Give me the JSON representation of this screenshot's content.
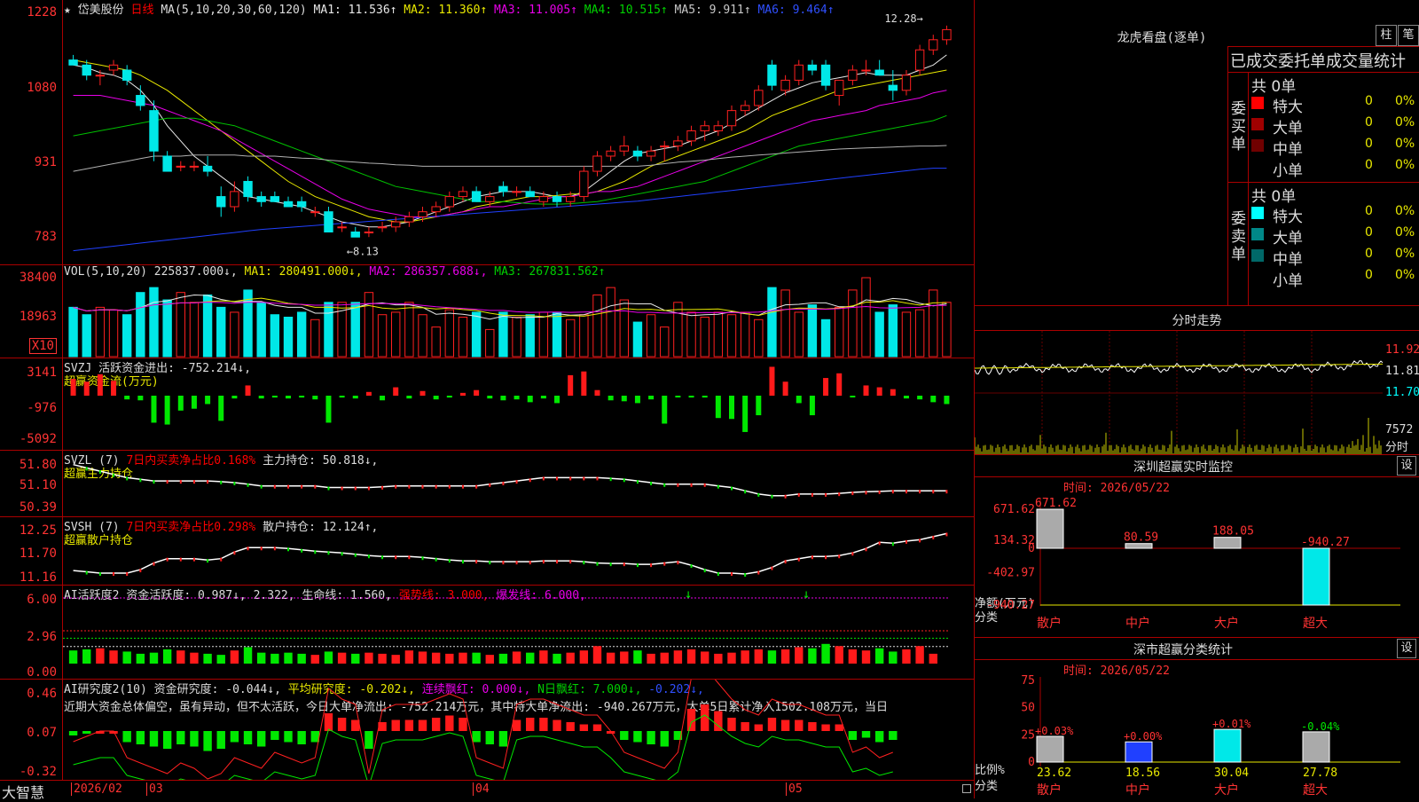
{
  "price": {
    "arrow": "★",
    "stock_name": "岱美股份",
    "period": "日线",
    "ma_params": "MA(5,10,20,30,60,120)",
    "mas": [
      {
        "label": "MA1: 11.536↑",
        "color": "#e8e8e8"
      },
      {
        "label": "MA2: 11.360↑",
        "color": "#e8e800"
      },
      {
        "label": "MA3: 11.005↑",
        "color": "#e800e8"
      },
      {
        "label": "MA4: 10.515↑",
        "color": "#00d000"
      },
      {
        "label": "MA5: 9.911↑",
        "color": "#c8c8c8"
      },
      {
        "label": "MA6: 9.464↑",
        "color": "#3050ff"
      }
    ],
    "y_labels": [
      "1228",
      "1080",
      "931",
      "783"
    ],
    "high_mark": "12.28",
    "low_mark": "8.13"
  },
  "volume": {
    "title": "VOL(5,10,20)",
    "value": "225837.000↓,",
    "ma1": "MA1: 280491.000↓,",
    "ma2": "MA2: 286357.688↓,",
    "ma3": "MA3: 267831.562↑",
    "y_labels": [
      "38400",
      "18963"
    ],
    "unit": "X10"
  },
  "svzj": {
    "title": "SVZJ  活跃资金进出:",
    "value": "-752.214↓,",
    "subtitle": "超赢资金流(万元)",
    "y_labels": [
      "3141",
      "-976",
      "-5092"
    ]
  },
  "svzl": {
    "title": "SVZL (7)",
    "ratio": "7日内买卖净占比0.168%",
    "hold": "主力持仓: 50.818↓,",
    "subtitle": "超赢主力持仓",
    "y_labels": [
      "51.80",
      "51.10",
      "50.39"
    ]
  },
  "svsh": {
    "title": "SVSH (7)",
    "ratio": "7日内买卖净占比0.298%",
    "hold": "散户持仓: 12.124↑,",
    "subtitle": "超赢散户持仓",
    "y_labels": [
      "12.25",
      "11.70",
      "11.16"
    ]
  },
  "ai_active": {
    "title": "AI活跃度2",
    "activity": "资金活跃度: 0.987↓,",
    "val2": "2.322,",
    "life": "生命线: 1.560,",
    "strong": "强势线: 3.000,",
    "burst": "爆发线: 6.000,",
    "y_labels": [
      "6.00",
      "2.96",
      "0.00"
    ]
  },
  "ai_research": {
    "title": "AI研究度2(10)",
    "research": "资金研究度: -0.044↓,",
    "avg": "平均研究度: -0.202↓,",
    "cont": "连续飘红: 0.000↓,",
    "nday": "N日飘红: 7.000↓,",
    "last": "-0.202↓,",
    "comment": "近期大资金总体偏空，虽有异动，但不太活跃，今日大单净流出: -752.214万元，其中特大单净流出: -940.267万元，大单5日累计净入1502.108万元，当日",
    "y_labels": [
      "0.46",
      "0.07",
      "-0.32"
    ]
  },
  "date_axis": {
    "logo": "大智慧",
    "labels": [
      "2026/02",
      "03",
      "04",
      "05"
    ]
  },
  "longhu": {
    "title": "龙虎看盘(逐单)",
    "btn_zhu": "柱",
    "btn_bi": "笔",
    "header": "已成交委托单成交量统计",
    "buy_label": "委买单",
    "sell_label": "委卖单",
    "buy_total": "共 0单",
    "sell_total": "共 0单",
    "buy_rows": [
      {
        "name": "特大",
        "value": "0",
        "pct": "0%",
        "color": "#ff0000"
      },
      {
        "name": "大单",
        "value": "0",
        "pct": "0%",
        "color": "#a00000"
      },
      {
        "name": "中单",
        "value": "0",
        "pct": "0%",
        "color": "#700000"
      },
      {
        "name": "小单",
        "value": "0",
        "pct": "0%",
        "color": ""
      }
    ],
    "sell_rows": [
      {
        "name": "特大",
        "value": "0",
        "pct": "0%",
        "color": "#00ffff"
      },
      {
        "name": "大单",
        "value": "0",
        "pct": "0%",
        "color": "#008888"
      },
      {
        "name": "中单",
        "value": "0",
        "pct": "0%",
        "color": "#006868"
      },
      {
        "name": "小单",
        "value": "0",
        "pct": "0%",
        "color": ""
      }
    ]
  },
  "fenshi": {
    "title": "分时走势",
    "y_labels": [
      "11.92",
      "11.81",
      "11.70"
    ],
    "vol_label": "7572",
    "vol_unit": "分时"
  },
  "sz_monitor": {
    "title": "深圳超赢实时监控",
    "btn": "设",
    "time": "时间: 2026/05/22",
    "y_labels": [
      "671.62",
      "134.32",
      "0",
      "-402.97",
      "-940.27"
    ],
    "y_unit": "净额(万元)",
    "x_unit": "分类",
    "bars": [
      {
        "name": "散户",
        "value": 671.62,
        "label": "671.62"
      },
      {
        "name": "中户",
        "value": 80.59,
        "label": "80.59"
      },
      {
        "name": "大户",
        "value": 188.05,
        "label": "188.05"
      },
      {
        "name": "超大",
        "value": -940.27,
        "label": "-940.27"
      }
    ]
  },
  "sz_stats": {
    "title": "深市超赢分类统计",
    "btn": "设",
    "time": "时间: 2026/05/22",
    "y_labels": [
      "75",
      "50",
      "25",
      "0"
    ],
    "y_unit": "比例%",
    "x_unit": "分类",
    "bars": [
      {
        "name": "散户",
        "value": 23.62,
        "label": "23.62",
        "chg": "+0.03%"
      },
      {
        "name": "中户",
        "value": 18.56,
        "label": "18.56",
        "chg": "+0.00%"
      },
      {
        "name": "大户",
        "value": 30.04,
        "label": "30.04",
        "chg": "+0.01%"
      },
      {
        "name": "超大",
        "value": 27.78,
        "label": "27.78",
        "chg": "-0.04%"
      }
    ]
  },
  "chart_data": {
    "type": "candlestick",
    "price_range": [
      7.83,
      12.28
    ],
    "ohlc": [
      [
        11.6,
        11.7,
        11.5,
        11.5
      ],
      [
        11.5,
        11.6,
        11.2,
        11.3
      ],
      [
        11.3,
        11.4,
        11.1,
        11.3
      ],
      [
        11.4,
        11.6,
        11.3,
        11.5
      ],
      [
        11.4,
        11.5,
        11.1,
        11.2
      ],
      [
        10.9,
        11.1,
        10.6,
        10.7
      ],
      [
        10.6,
        10.8,
        9.6,
        9.8
      ],
      [
        9.7,
        9.8,
        9.4,
        9.4
      ],
      [
        9.5,
        9.6,
        9.4,
        9.5
      ],
      [
        9.5,
        9.6,
        9.4,
        9.5
      ],
      [
        9.5,
        9.7,
        9.3,
        9.4
      ],
      [
        8.9,
        9.1,
        8.5,
        8.7
      ],
      [
        8.7,
        9.2,
        8.6,
        9.0
      ],
      [
        9.2,
        9.3,
        8.8,
        8.9
      ],
      [
        8.9,
        9.0,
        8.7,
        8.8
      ],
      [
        8.9,
        9.0,
        8.8,
        8.8
      ],
      [
        8.8,
        8.9,
        8.7,
        8.7
      ],
      [
        8.8,
        8.9,
        8.6,
        8.7
      ],
      [
        8.6,
        8.7,
        8.5,
        8.6
      ],
      [
        8.6,
        8.7,
        8.2,
        8.2
      ],
      [
        8.3,
        8.4,
        8.2,
        8.3
      ],
      [
        8.2,
        8.3,
        8.1,
        8.1
      ],
      [
        8.2,
        8.3,
        8.1,
        8.2
      ],
      [
        8.3,
        8.4,
        8.2,
        8.3
      ],
      [
        8.3,
        8.5,
        8.2,
        8.4
      ],
      [
        8.4,
        8.6,
        8.3,
        8.5
      ],
      [
        8.5,
        8.7,
        8.4,
        8.6
      ],
      [
        8.6,
        8.8,
        8.5,
        8.7
      ],
      [
        8.7,
        9.0,
        8.6,
        8.9
      ],
      [
        8.9,
        9.1,
        8.8,
        9.0
      ],
      [
        9.0,
        9.1,
        8.8,
        8.8
      ],
      [
        8.8,
        9.0,
        8.7,
        8.9
      ],
      [
        9.1,
        9.2,
        8.9,
        9.0
      ],
      [
        9.0,
        9.1,
        8.9,
        9.0
      ],
      [
        9.0,
        9.1,
        8.9,
        8.9
      ],
      [
        8.8,
        9.0,
        8.7,
        8.9
      ],
      [
        8.9,
        9.0,
        8.7,
        8.8
      ],
      [
        8.8,
        9.0,
        8.7,
        8.9
      ],
      [
        8.9,
        9.5,
        8.8,
        9.4
      ],
      [
        9.4,
        9.8,
        9.3,
        9.7
      ],
      [
        9.7,
        9.9,
        9.6,
        9.8
      ],
      [
        9.8,
        10.1,
        9.7,
        9.9
      ],
      [
        9.8,
        9.9,
        9.6,
        9.7
      ],
      [
        9.7,
        9.9,
        9.6,
        9.8
      ],
      [
        9.9,
        10.0,
        9.6,
        9.9
      ],
      [
        9.9,
        10.1,
        9.8,
        10.0
      ],
      [
        10.0,
        10.3,
        9.9,
        10.2
      ],
      [
        10.2,
        10.4,
        10.0,
        10.3
      ],
      [
        10.2,
        10.4,
        10.1,
        10.3
      ],
      [
        10.3,
        10.7,
        10.2,
        10.6
      ],
      [
        10.6,
        10.8,
        10.5,
        10.7
      ],
      [
        10.7,
        11.1,
        10.6,
        11.0
      ],
      [
        11.5,
        11.6,
        11.0,
        11.1
      ],
      [
        11.0,
        11.3,
        10.9,
        11.2
      ],
      [
        11.2,
        11.6,
        11.1,
        11.5
      ],
      [
        11.5,
        11.6,
        11.3,
        11.4
      ],
      [
        11.5,
        11.6,
        11.0,
        11.1
      ],
      [
        10.9,
        11.2,
        10.7,
        11.2
      ],
      [
        11.2,
        11.5,
        11.1,
        11.4
      ],
      [
        11.4,
        11.6,
        11.3,
        11.4
      ],
      [
        11.4,
        11.6,
        11.3,
        11.3
      ],
      [
        11.1,
        11.4,
        10.8,
        11.0
      ],
      [
        11.0,
        11.4,
        10.9,
        11.3
      ],
      [
        11.4,
        11.9,
        11.3,
        11.8
      ],
      [
        11.8,
        12.1,
        11.7,
        12.0
      ],
      [
        12.0,
        12.28,
        11.9,
        12.2
      ]
    ],
    "volume": [
      20,
      17,
      20,
      19,
      17,
      26,
      28,
      23,
      26,
      22,
      25,
      20,
      18,
      27,
      22,
      17,
      16,
      18,
      15,
      22,
      22,
      22,
      26,
      17,
      18,
      22,
      17,
      12,
      19,
      16,
      18,
      11,
      18,
      16,
      17,
      18,
      18,
      15,
      17,
      25,
      28,
      23,
      14,
      17,
      12,
      22,
      18,
      16,
      18,
      17,
      18,
      15,
      28,
      27,
      18,
      21,
      15,
      20,
      27,
      32,
      18,
      21,
      18,
      19,
      27,
      22
    ],
    "svzj": [
      1800,
      1500,
      2300,
      1600,
      -400,
      -500,
      -2900,
      -3100,
      -1600,
      -1400,
      -900,
      -2700,
      -300,
      1100,
      -300,
      -200,
      -300,
      -200,
      -400,
      -2900,
      -200,
      -300,
      400,
      -500,
      900,
      -300,
      500,
      -400,
      -200,
      300,
      600,
      -300,
      -500,
      -400,
      -700,
      -300,
      -800,
      2200,
      2600,
      600,
      -500,
      -600,
      -800,
      -400,
      -3000,
      -100,
      -200,
      -200,
      -2400,
      -2500,
      -3900,
      -2100,
      3100,
      1500,
      -800,
      -2100,
      1900,
      2400,
      -100,
      1100,
      900,
      700,
      -300,
      -400,
      -700,
      -900
    ],
    "svzl": [
      51.7,
      51.6,
      51.5,
      51.4,
      51.3,
      51.25,
      51.2,
      51.2,
      51.2,
      51.2,
      51.2,
      51.18,
      51.15,
      51.1,
      51.05,
      51.05,
      51.05,
      51.05,
      51.05,
      51.0,
      51.0,
      51.0,
      51.0,
      51.02,
      51.05,
      51.05,
      51.05,
      51.05,
      51.05,
      51.05,
      51.05,
      51.1,
      51.15,
      51.2,
      51.25,
      51.3,
      51.3,
      51.3,
      51.3,
      51.3,
      51.28,
      51.25,
      51.2,
      51.15,
      51.1,
      51.1,
      51.1,
      51.1,
      51.05,
      51.0,
      50.9,
      50.8,
      50.75,
      50.75,
      50.8,
      50.8,
      50.8,
      50.82,
      50.85,
      50.87,
      50.88,
      50.9,
      50.9,
      50.9,
      50.9,
      50.9
    ],
    "svsh": [
      11.28,
      11.25,
      11.22,
      11.22,
      11.22,
      11.3,
      11.45,
      11.55,
      11.55,
      11.55,
      11.52,
      11.55,
      11.7,
      11.8,
      11.8,
      11.8,
      11.78,
      11.75,
      11.72,
      11.7,
      11.68,
      11.65,
      11.62,
      11.6,
      11.6,
      11.6,
      11.58,
      11.55,
      11.52,
      11.5,
      11.5,
      11.48,
      11.48,
      11.48,
      11.48,
      11.5,
      11.5,
      11.5,
      11.48,
      11.45,
      11.44,
      11.44,
      11.42,
      11.42,
      11.45,
      11.48,
      11.4,
      11.3,
      11.22,
      11.22,
      11.2,
      11.25,
      11.35,
      11.5,
      11.55,
      11.6,
      11.6,
      11.62,
      11.68,
      11.78,
      11.92,
      11.9,
      11.95,
      11.98,
      12.05,
      12.12
    ],
    "ai_active": [
      1.2,
      1.3,
      1.4,
      1.2,
      1.1,
      0.9,
      1.0,
      1.3,
      1.2,
      1.0,
      0.9,
      0.8,
      1.2,
      1.5,
      1.0,
      0.9,
      1.0,
      0.9,
      0.8,
      1.1,
      1.0,
      0.9,
      1.0,
      0.9,
      0.8,
      1.2,
      1.1,
      1.0,
      0.9,
      1.0,
      1.0,
      0.8,
      0.9,
      1.1,
      1.0,
      1.2,
      0.9,
      1.0,
      1.2,
      1.6,
      1.0,
      1.1,
      1.2,
      0.9,
      1.0,
      1.2,
      1.3,
      1.1,
      0.9,
      1.0,
      1.2,
      1.3,
      1.2,
      1.3,
      1.5,
      1.4,
      1.8,
      1.6,
      1.3,
      1.2,
      1.4,
      1.1,
      1.3,
      1.6,
      0.9
    ],
    "ai_research": [
      -0.02,
      -0.01,
      0.0,
      0.0,
      -0.05,
      -0.06,
      -0.07,
      -0.08,
      -0.06,
      -0.07,
      -0.09,
      -0.08,
      -0.05,
      -0.06,
      -0.07,
      -0.04,
      -0.05,
      -0.06,
      -0.05,
      0.08,
      0.06,
      0.05,
      -0.08,
      0.04,
      0.05,
      0.05,
      0.05,
      0.06,
      0.07,
      0.06,
      -0.05,
      -0.06,
      -0.07,
      0.05,
      0.06,
      0.06,
      0.05,
      0.04,
      0.03,
      0.03,
      0.0,
      -0.04,
      -0.05,
      -0.06,
      -0.07,
      -0.04,
      0.1,
      0.12,
      0.09,
      0.06,
      0.04,
      0.03,
      0.06,
      0.05,
      0.05,
      0.04,
      0.03,
      0.03,
      -0.04,
      -0.03,
      -0.05,
      -0.04
    ],
    "ma_lines": {
      "ma1": [
        11.5,
        11.45,
        11.35,
        11.3,
        11.2,
        11.0,
        10.7,
        10.3,
        10.0,
        9.7,
        9.5,
        9.3,
        9.1,
        8.9,
        8.85,
        8.8,
        8.75,
        8.7,
        8.6,
        8.5,
        8.4,
        8.35,
        8.3,
        8.3,
        8.35,
        8.4,
        8.5,
        8.6,
        8.7,
        8.8,
        8.9,
        8.95,
        9.0,
        9.0,
        9.0,
        8.95,
        8.9,
        8.9,
        9.0,
        9.2,
        9.4,
        9.6,
        9.75,
        9.8,
        9.85,
        9.9,
        10.0,
        10.1,
        10.2,
        10.35,
        10.5,
        10.65,
        10.8,
        10.95,
        11.05,
        11.15,
        11.2,
        11.25,
        11.3,
        11.35,
        11.3,
        11.3,
        11.3,
        11.4,
        11.5,
        11.7
      ],
      "ma2": [
        11.6,
        11.55,
        11.5,
        11.45,
        11.4,
        11.3,
        11.15,
        11.0,
        10.8,
        10.6,
        10.4,
        10.2,
        10.0,
        9.8,
        9.6,
        9.4,
        9.2,
        9.05,
        8.9,
        8.8,
        8.7,
        8.6,
        8.5,
        8.45,
        8.4,
        8.4,
        8.45,
        8.5,
        8.55,
        8.6,
        8.7,
        8.75,
        8.8,
        8.85,
        8.9,
        8.9,
        8.92,
        8.95,
        8.95,
        9.0,
        9.1,
        9.2,
        9.35,
        9.5,
        9.6,
        9.7,
        9.8,
        9.9,
        10.0,
        10.1,
        10.2,
        10.35,
        10.5,
        10.6,
        10.7,
        10.8,
        10.9,
        11.0,
        11.05,
        11.1,
        11.15,
        11.2,
        11.25,
        11.3,
        11.35,
        11.4
      ],
      "ma3": [
        10.9,
        10.9,
        10.9,
        10.85,
        10.8,
        10.75,
        10.7,
        10.6,
        10.5,
        10.4,
        10.3,
        10.2,
        10.05,
        9.9,
        9.75,
        9.6,
        9.45,
        9.3,
        9.15,
        9.0,
        8.85,
        8.75,
        8.65,
        8.6,
        8.55,
        8.5,
        8.5,
        8.5,
        8.55,
        8.6,
        8.65,
        8.7,
        8.7,
        8.75,
        8.8,
        8.85,
        8.9,
        8.9,
        8.95,
        9.0,
        9.0,
        9.05,
        9.1,
        9.2,
        9.3,
        9.4,
        9.5,
        9.6,
        9.7,
        9.8,
        9.9,
        10.0,
        10.1,
        10.2,
        10.3,
        10.4,
        10.45,
        10.5,
        10.55,
        10.6,
        10.7,
        10.75,
        10.8,
        10.85,
        10.95,
        11.0
      ],
      "ma4": [
        10.1,
        10.15,
        10.2,
        10.25,
        10.3,
        10.35,
        10.4,
        10.45,
        10.45,
        10.45,
        10.4,
        10.35,
        10.3,
        10.2,
        10.1,
        10.0,
        9.9,
        9.8,
        9.7,
        9.6,
        9.5,
        9.4,
        9.3,
        9.2,
        9.1,
        9.05,
        9.0,
        8.95,
        8.9,
        8.85,
        8.8,
        8.8,
        8.8,
        8.78,
        8.76,
        8.75,
        8.75,
        8.76,
        8.78,
        8.8,
        8.85,
        8.9,
        8.95,
        9.0,
        9.05,
        9.1,
        9.15,
        9.2,
        9.3,
        9.4,
        9.5,
        9.6,
        9.7,
        9.8,
        9.9,
        9.95,
        10.0,
        10.05,
        10.1,
        10.15,
        10.2,
        10.25,
        10.3,
        10.35,
        10.4,
        10.5
      ],
      "ma5": [
        9.4,
        9.45,
        9.5,
        9.55,
        9.6,
        9.65,
        9.7,
        9.7,
        9.7,
        9.72,
        9.72,
        9.72,
        9.72,
        9.7,
        9.7,
        9.7,
        9.68,
        9.66,
        9.65,
        9.62,
        9.6,
        9.58,
        9.56,
        9.55,
        9.53,
        9.52,
        9.5,
        9.5,
        9.5,
        9.5,
        9.5,
        9.5,
        9.5,
        9.5,
        9.5,
        9.5,
        9.5,
        9.5,
        9.5,
        9.5,
        9.5,
        9.5,
        9.5,
        9.52,
        9.55,
        9.58,
        9.6,
        9.62,
        9.65,
        9.68,
        9.7,
        9.72,
        9.74,
        9.76,
        9.78,
        9.8,
        9.82,
        9.84,
        9.85,
        9.86,
        9.87,
        9.88,
        9.89,
        9.9,
        9.9,
        9.91
      ],
      "ma6": [
        7.83,
        7.86,
        7.89,
        7.92,
        7.95,
        7.98,
        8.01,
        8.04,
        8.07,
        8.1,
        8.13,
        8.16,
        8.19,
        8.22,
        8.25,
        8.27,
        8.29,
        8.31,
        8.33,
        8.35,
        8.37,
        8.39,
        8.41,
        8.43,
        8.45,
        8.47,
        8.49,
        8.51,
        8.53,
        8.55,
        8.57,
        8.59,
        8.61,
        8.63,
        8.65,
        8.67,
        8.69,
        8.71,
        8.73,
        8.75,
        8.77,
        8.79,
        8.81,
        8.84,
        8.87,
        8.9,
        8.93,
        8.96,
        8.99,
        9.02,
        9.05,
        9.08,
        9.11,
        9.14,
        9.17,
        9.2,
        9.23,
        9.26,
        9.29,
        9.32,
        9.35,
        9.38,
        9.41,
        9.44,
        9.46,
        9.46
      ]
    }
  }
}
